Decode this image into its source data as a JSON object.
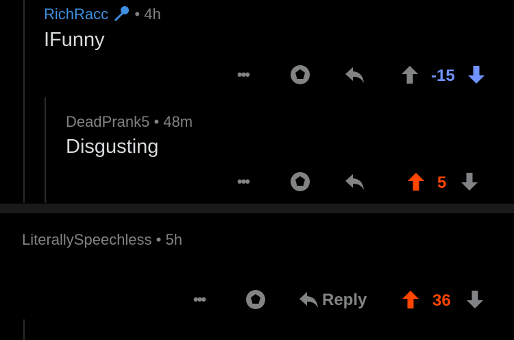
{
  "comments": [
    {
      "author": "RichRacc",
      "author_color": "#3d8fe0",
      "badge_icon": "microphone-icon",
      "timestamp": "4h",
      "text": "IFunny",
      "more": "•••",
      "score": "-15",
      "vote_state": "downvoted",
      "score_color": "#7193ff"
    },
    {
      "author": "DeadPrank5",
      "timestamp": "48m",
      "text": "Disgusting",
      "more": "•••",
      "score": "5",
      "vote_state": "upvoted",
      "score_color": "#ff4500"
    },
    {
      "author": "LiterallySpeechless",
      "timestamp": "5h",
      "text": "",
      "more": "•••",
      "reply_label": "Reply",
      "score": "36",
      "vote_state": "upvoted",
      "score_color": "#ff4500"
    }
  ],
  "separator_dot": "•"
}
